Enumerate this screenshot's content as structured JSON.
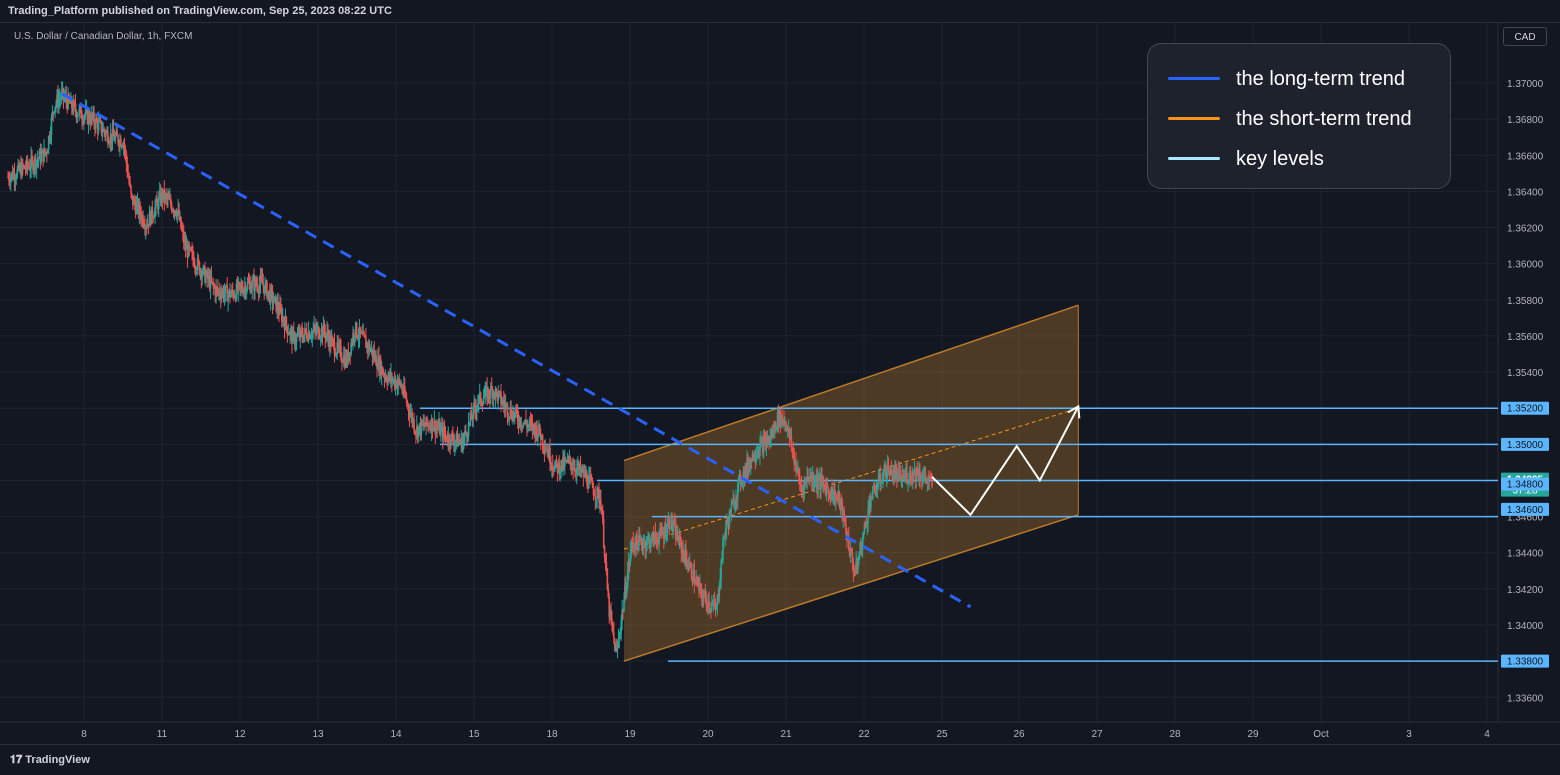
{
  "header": {
    "publish_text": "Trading_Platform published on TradingView.com, Sep 25, 2023 08:22 UTC",
    "symbol": "U.S. Dollar / Canadian Dollar, 1h, FXCM",
    "currency_button": "CAD"
  },
  "footer": {
    "brand": "TradingView",
    "logo_icon": "tradingview-logo-icon"
  },
  "legend": [
    {
      "label": "the long-term trend",
      "color": "#2962ff"
    },
    {
      "label": "the short-term trend",
      "color": "#f7931a"
    },
    {
      "label": "key levels",
      "color": "#a7ebff"
    }
  ],
  "colors": {
    "background": "#131722",
    "up": "#26a69a",
    "down": "#ef5350",
    "level": "#5bb6ff",
    "channel": "#b97a2b"
  },
  "chart_data": {
    "type": "candlestick",
    "title": "",
    "instrument": "U.S. Dollar / Canadian Dollar",
    "interval": "1h",
    "source": "FXCM",
    "x_labels": [
      "8",
      "11",
      "12",
      "13",
      "14",
      "15",
      "18",
      "19",
      "20",
      "21",
      "22",
      "25",
      "26",
      "27",
      "28",
      "29",
      "Oct",
      "3",
      "4"
    ],
    "y_ticks": [
      "1.37000",
      "1.36800",
      "1.36600",
      "1.36400",
      "1.36200",
      "1.36000",
      "1.35800",
      "1.35600",
      "1.35400",
      "1.35200",
      "1.35000",
      "1.34800",
      "1.34600",
      "1.34400",
      "1.34200",
      "1.34000",
      "1.33800",
      "1.33600"
    ],
    "ylim": [
      1.3345,
      1.3728
    ],
    "price_path": [
      [
        0,
        1.3648
      ],
      [
        3,
        1.3655
      ],
      [
        5,
        1.3662
      ],
      [
        6,
        1.3688
      ],
      [
        7,
        1.3693
      ],
      [
        9,
        1.3684
      ],
      [
        11,
        1.368
      ],
      [
        13,
        1.3671
      ],
      [
        15,
        1.3668
      ],
      [
        16,
        1.3636
      ],
      [
        18,
        1.3622
      ],
      [
        20,
        1.3638
      ],
      [
        22,
        1.3629
      ],
      [
        23,
        1.3609
      ],
      [
        25,
        1.3597
      ],
      [
        27,
        1.3585
      ],
      [
        29,
        1.3583
      ],
      [
        31,
        1.3588
      ],
      [
        33,
        1.3589
      ],
      [
        35,
        1.3576
      ],
      [
        37,
        1.3558
      ],
      [
        39,
        1.3562
      ],
      [
        41,
        1.3563
      ],
      [
        42,
        1.3556
      ],
      [
        44,
        1.3546
      ],
      [
        45,
        1.3564
      ],
      [
        47,
        1.3553
      ],
      [
        49,
        1.3538
      ],
      [
        51,
        1.3533
      ],
      [
        53,
        1.3508
      ],
      [
        55,
        1.3512
      ],
      [
        57,
        1.3504
      ],
      [
        59,
        1.3501
      ],
      [
        61,
        1.3524
      ],
      [
        63,
        1.353
      ],
      [
        65,
        1.3519
      ],
      [
        67,
        1.3512
      ],
      [
        69,
        1.3507
      ],
      [
        71,
        1.3487
      ],
      [
        73,
        1.349
      ],
      [
        75,
        1.3482
      ],
      [
        77,
        1.3469
      ],
      [
        78,
        1.341
      ],
      [
        79,
        1.3383
      ],
      [
        81,
        1.3445
      ],
      [
        83,
        1.3446
      ],
      [
        85,
        1.345
      ],
      [
        86,
        1.3458
      ],
      [
        88,
        1.3437
      ],
      [
        90,
        1.3417
      ],
      [
        92,
        1.3408
      ],
      [
        93,
        1.345
      ],
      [
        95,
        1.3479
      ],
      [
        97,
        1.3496
      ],
      [
        99,
        1.3503
      ],
      [
        100,
        1.3515
      ],
      [
        101,
        1.3513
      ],
      [
        103,
        1.3475
      ],
      [
        104,
        1.3483
      ],
      [
        106,
        1.3477
      ],
      [
        108,
        1.3469
      ],
      [
        110,
        1.3428
      ],
      [
        111,
        1.3448
      ],
      [
        112,
        1.347
      ],
      [
        114,
        1.3486
      ],
      [
        116,
        1.3481
      ],
      [
        118,
        1.3485
      ],
      [
        120,
        1.3478
      ]
    ],
    "key_levels": [
      1.352,
      1.35,
      1.348,
      1.346,
      1.338
    ],
    "price_labels": [
      {
        "value": "1.35200",
        "bg": "#5bb6ff",
        "fg": "#131722"
      },
      {
        "value": "1.35000",
        "bg": "#5bb6ff",
        "fg": "#131722"
      },
      {
        "value": "1.34805",
        "bg": "#26a69a",
        "fg": "#ffffff",
        "sub": "37:28"
      },
      {
        "value": "1.34800",
        "bg": "#5bb6ff",
        "fg": "#131722"
      },
      {
        "value": "1.34600",
        "bg": "#5bb6ff",
        "fg": "#131722"
      },
      {
        "value": "1.33800",
        "bg": "#5bb6ff",
        "fg": "#131722"
      }
    ],
    "last_price": 1.34805,
    "countdown": "37:28",
    "long_term_trend": {
      "from": [
        7,
        1.3694
      ],
      "to": [
        125,
        1.341
      ]
    },
    "short_term_channel": {
      "lower": {
        "from": [
          80,
          1.338
        ],
        "to": [
          139,
          1.3461
        ]
      },
      "upper": {
        "from": [
          80,
          1.3491
        ],
        "to": [
          139,
          1.3577
        ]
      },
      "mid": {
        "from": [
          80,
          1.3442
        ],
        "to": [
          139,
          1.352
        ]
      }
    },
    "projection": [
      [
        120,
        1.3482
      ],
      [
        125,
        1.3461
      ],
      [
        131,
        1.3499
      ],
      [
        134,
        1.348
      ],
      [
        139,
        1.3521
      ]
    ],
    "grid": true
  }
}
